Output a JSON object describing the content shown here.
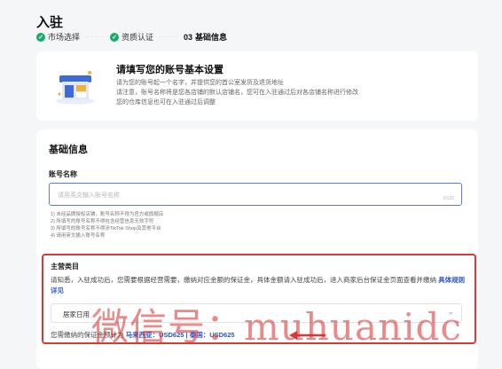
{
  "page": {
    "title": "入驻"
  },
  "steps": [
    {
      "label": "市场选择",
      "done": true
    },
    {
      "label": "资质认证",
      "done": true
    },
    {
      "number": "03",
      "label": "基础信息",
      "done": false
    }
  ],
  "intro": {
    "title": "请填写您的账号基本设置",
    "lines": [
      "请为您的账号起一个名字，并提供您的首公室发货及退货地址",
      "请注意，账号名称将是您各店铺的默认店铺名，您可在入驻通过后对各店铺名称进行修改",
      "您的仓库信息也可在入驻通过后调整"
    ]
  },
  "form": {
    "section_title": "基础信息",
    "account_label": "账号名称",
    "account_input": {
      "placeholder": "请用英文输入账号名称",
      "value": "",
      "counter": "0/120"
    },
    "rules": [
      "1) 未经品牌授权店铺，账号名称不得为官方或旗舰店",
      "2) 所填写的账号名称不得包含经营信息无效字符",
      "3) 所填写的账号名称不得涉TikTok Shop及其他平台",
      "4) 请用英文输入账号名称"
    ],
    "category": {
      "label": "主营类目",
      "desc": "请知悉，入驻成功后，您需要根据经营需要，缴纳对应金额的保证金，具体金额请入驻成功后，进入商家后台保证金页面查看并缴纳",
      "desc_link": "具体规则详见",
      "selected": "居家日用",
      "deposit_prefix": "您需缴纳的保证金预计为",
      "deposit_amounts": "马来西亚：USD625 | 泰国：USD625"
    }
  },
  "watermark": "微信号：muhuanidc",
  "colors": {
    "accent_green": "#1aab6a",
    "link_blue": "#2e55c8",
    "highlight_red": "#d93a36"
  },
  "icons": {
    "step_done": "check-circle-icon",
    "select": "chevron-down-icon",
    "illustration": "store-illustration-icon",
    "annotation": "red-arrow-icon"
  }
}
